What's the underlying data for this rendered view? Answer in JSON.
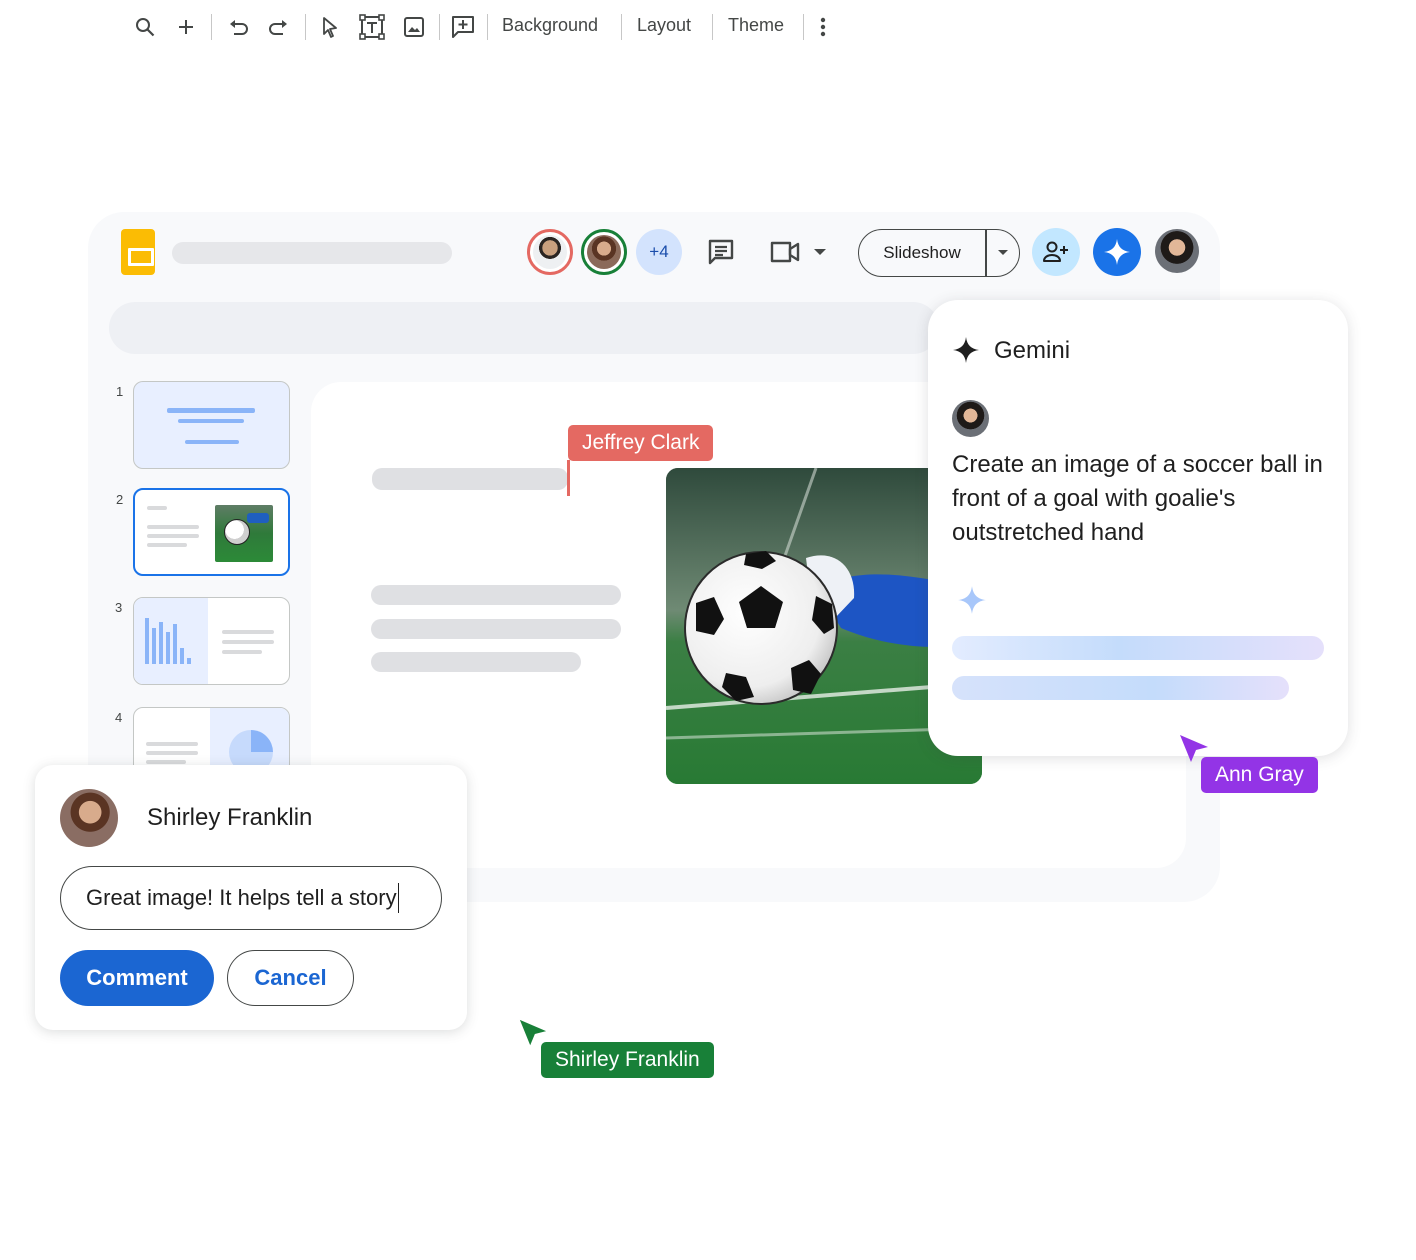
{
  "header": {
    "collaborator_overflow": "+4",
    "slideshow_label": "Slideshow"
  },
  "toolbar": {
    "background_label": "Background",
    "layout_label": "Layout",
    "theme_label": "Theme"
  },
  "filmstrip": {
    "slides": [
      {
        "number": "1"
      },
      {
        "number": "2"
      },
      {
        "number": "3"
      },
      {
        "number": "4"
      }
    ]
  },
  "cursors": {
    "jeffrey": "Jeffrey Clark",
    "ann": "Ann Gray",
    "shirley": "Shirley Franklin"
  },
  "cursor_colors": {
    "jeffrey": "#e46962",
    "ann": "#9334e6",
    "shirley": "#188038"
  },
  "gemini": {
    "title": "Gemini",
    "prompt": "Create an image of a soccer ball in front of a goal with goalie's outstretched hand"
  },
  "comment": {
    "author": "Shirley Franklin",
    "input_value": "Great image! It helps tell a story",
    "comment_label": "Comment",
    "cancel_label": "Cancel"
  },
  "icons": {
    "app": "slides-logo-icon",
    "comments": "comments-icon",
    "meet": "video-call-icon",
    "share": "add-person-icon",
    "gemini": "gemini-sparkle-icon"
  },
  "colors": {
    "accent": "#1a73e8",
    "comment_button": "#1b66d2",
    "slides_yellow": "#fbbc04"
  }
}
